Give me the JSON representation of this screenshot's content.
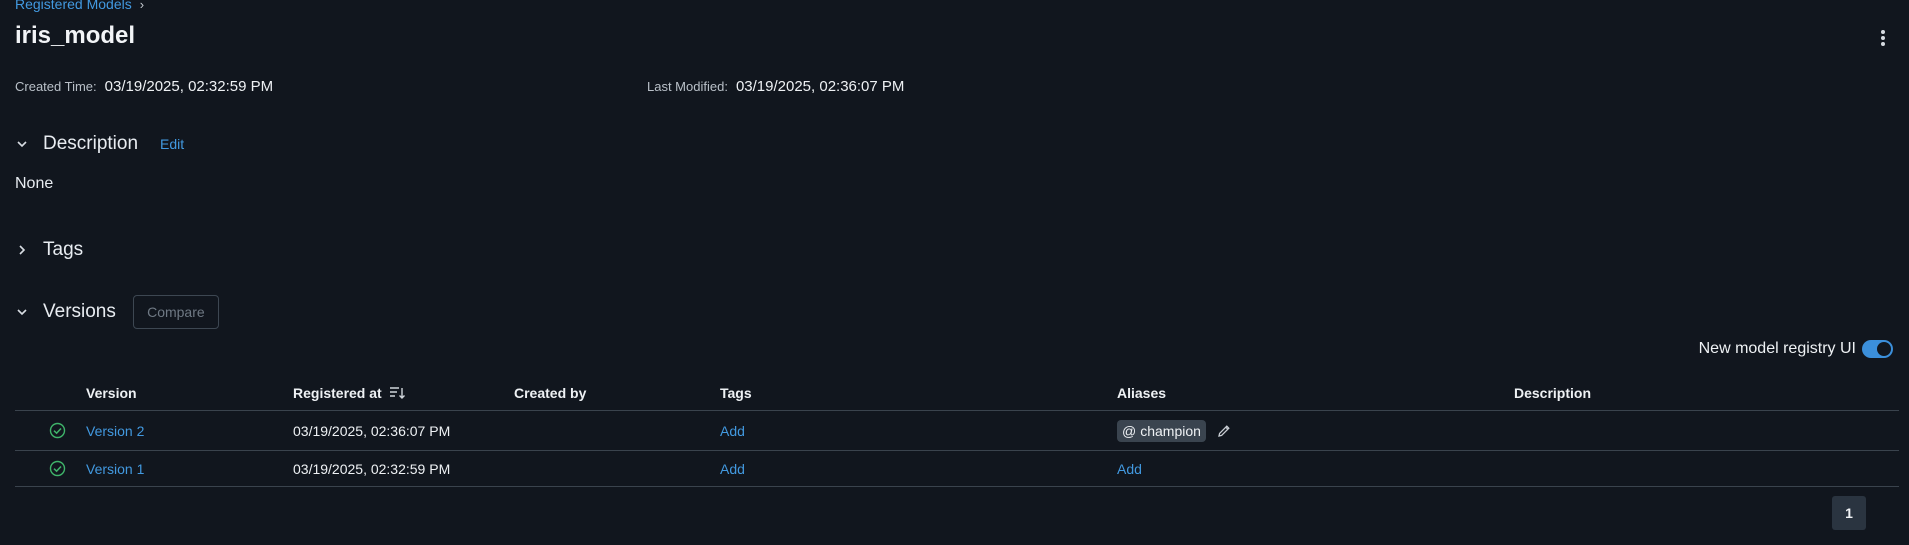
{
  "breadcrumb": {
    "root": "Registered Models",
    "separator": "›"
  },
  "model": {
    "name": "iris_model"
  },
  "meta": {
    "created_label": "Created Time:",
    "created_value": "03/19/2025, 02:32:59 PM",
    "modified_label": "Last Modified:",
    "modified_value": "03/19/2025, 02:36:07 PM"
  },
  "description": {
    "title": "Description",
    "edit_label": "Edit",
    "value": "None"
  },
  "tags": {
    "title": "Tags"
  },
  "versions": {
    "title": "Versions",
    "compare_label": "Compare",
    "toggle_label": "New model registry UI",
    "toggle_on": true,
    "columns": [
      "Version",
      "Registered at",
      "Created by",
      "Tags",
      "Aliases",
      "Description"
    ],
    "rows": [
      {
        "version": "Version 2",
        "registered_at": "03/19/2025, 02:36:07 PM",
        "created_by": "",
        "tags": "Add",
        "alias": "champion",
        "alias_prefix": "@",
        "description": ""
      },
      {
        "version": "Version 1",
        "registered_at": "03/19/2025, 02:32:59 PM",
        "created_by": "",
        "tags": "Add",
        "alias_add": "Add",
        "description": ""
      }
    ]
  },
  "pagination": {
    "current_page": "1"
  },
  "colors": {
    "accent": "#4299e0",
    "status_ready": "#3fb46a",
    "background": "#11161e"
  }
}
